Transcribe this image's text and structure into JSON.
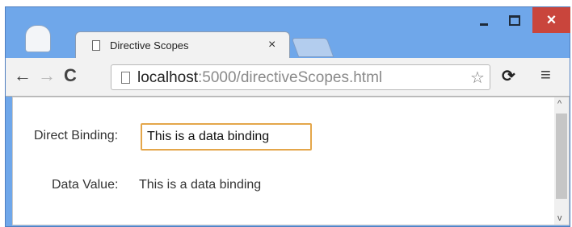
{
  "window": {
    "minimize_icon": "minimize-icon",
    "maximize_icon": "maximize-icon",
    "close_glyph": "×"
  },
  "tab": {
    "title": "Directive Scopes",
    "close_glyph": "×"
  },
  "toolbar": {
    "back_glyph": "←",
    "forward_glyph": "→",
    "reload_glyph": "C",
    "url_host": "localhost",
    "url_rest": ":5000/directiveScopes.html",
    "star_glyph": "☆",
    "ext_glyph": "⟳",
    "menu_glyph": "≡"
  },
  "content": {
    "direct_label": "Direct Binding:",
    "direct_value": "This is a data binding",
    "data_label": "Data Value:",
    "data_value": "This is a data binding"
  },
  "scrollbar": {
    "up_glyph": "^",
    "down_glyph": "v"
  },
  "colors": {
    "window_frame": "#6fa7ea",
    "close_button": "#c9453c",
    "input_focus_border": "#e4a64a"
  }
}
